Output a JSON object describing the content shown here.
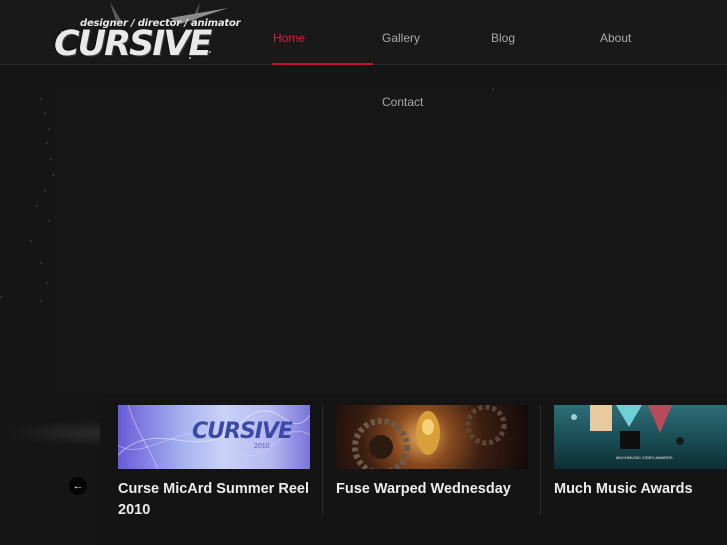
{
  "logo": {
    "tagline": "designer / director / animator",
    "wordmark": "CURSIVE"
  },
  "nav": {
    "items": [
      {
        "label": "Home",
        "active": true
      },
      {
        "label": "Gallery",
        "active": false
      },
      {
        "label": "Blog",
        "active": false
      },
      {
        "label": "About",
        "active": false
      },
      {
        "label": "Contact",
        "active": false
      }
    ]
  },
  "slider": {
    "prev_icon": "arrow-left-icon",
    "cards": [
      {
        "title": "Curse MicArd Summer Reel 2010",
        "thumb_text": "CURSIVE",
        "thumb_subtext": "2010"
      },
      {
        "title": "Fuse Warped Wednesday"
      },
      {
        "title": "Much Music Awards",
        "thumb_text": "MUCHMUSIC VIDEO AWARDS"
      }
    ]
  },
  "colors": {
    "accent": "#e01c3d",
    "background": "#151516",
    "header": "#19191a"
  }
}
